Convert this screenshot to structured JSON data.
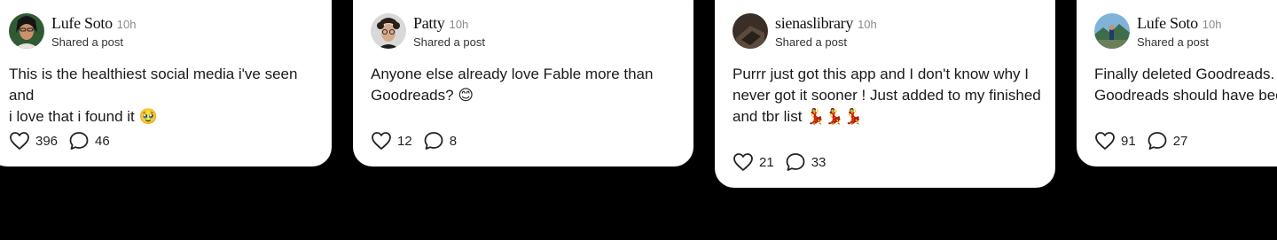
{
  "posts": [
    {
      "name": "Lufe Soto",
      "time": "10h",
      "subtitle": "Shared a post",
      "text_line1": "This is the healthiest social media i've seen and",
      "text_line2": "i love that i found it",
      "emoji": "🥹",
      "likes": "396",
      "comments": "46",
      "avatar": "woman-with-glasses-photo"
    },
    {
      "name": "Patty",
      "time": "10h",
      "subtitle": "Shared a post",
      "text_line1": "Anyone else already love Fable more than",
      "text_line2": "Goodreads?",
      "emoji": "😊",
      "likes": "12",
      "comments": "8",
      "avatar": "curly-hair-person-photo"
    },
    {
      "name": "sienaslibrary",
      "time": "10h",
      "subtitle": "Shared a post",
      "text_line1": "Purrr just got this app and I don't know why I",
      "text_line2": "never got it sooner ! Just added to my finished",
      "text_line3": "and tbr list",
      "emoji": "💃💃💃",
      "likes": "21",
      "comments": "33",
      "avatar": "dark-object-photo"
    },
    {
      "name": "Lufe Soto",
      "time": "10h",
      "subtitle": "Shared a post",
      "text_line1": "Finally deleted Goodreads. F",
      "text_line2": "Goodreads should have been",
      "likes": "91",
      "comments": "27",
      "avatar": "landscape-photo"
    }
  ],
  "colors": {
    "background": "#000000",
    "card": "#ffffff",
    "muted_text": "#8a8a8a"
  },
  "icons": {
    "like": "heart-icon",
    "comment": "comment-bubble-icon"
  }
}
